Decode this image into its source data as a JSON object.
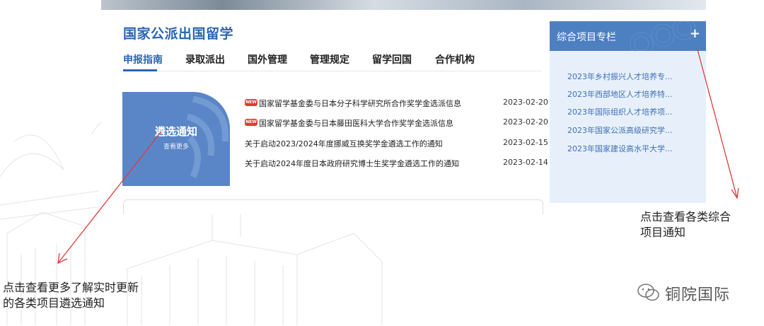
{
  "page": {
    "title": "国家公派出国留学",
    "tabs": [
      {
        "label": "申报指南",
        "active": true
      },
      {
        "label": "录取派出",
        "active": false
      },
      {
        "label": "国外管理",
        "active": false
      },
      {
        "label": "管理规定",
        "active": false
      },
      {
        "label": "留学回国",
        "active": false
      },
      {
        "label": "合作机构",
        "active": false
      }
    ]
  },
  "notice_box": {
    "title": "遴选通知",
    "more": "查看更多"
  },
  "news": [
    {
      "badge": "NEW",
      "title": "国家留学基金委与日本分子科学研究所合作奖学金选派信息",
      "date": "2023-02-20"
    },
    {
      "badge": "NEW",
      "title": "国家留学基金委与日本藤田医科大学合作奖学金选派信息",
      "date": "2023-02-20"
    },
    {
      "badge": "",
      "title": "关于启动2023/2024年度挪威互换奖学金遴选工作的通知",
      "date": "2023-02-15"
    },
    {
      "badge": "",
      "title": "关于启动2024年度日本政府研究博士生奖学金遴选工作的通知",
      "date": "2023-02-14"
    }
  ],
  "side_panel": {
    "title": "综合项目专栏",
    "plus": "+",
    "items": [
      "2023年乡村振兴人才培养专...",
      "2023年西部地区人才培养特...",
      "2023年国际组织人才培养项...",
      "2023年国家公派高级研究学...",
      "2023年国家建设高水平大学..."
    ]
  },
  "annotations": {
    "right": [
      "点击查看各类综合",
      "项目通知"
    ],
    "left": [
      "点击查看更多了解实时更新",
      "的各类项目遴选通知"
    ]
  },
  "watermark": "铜院国际",
  "colors": {
    "brand_blue": "#2a64b4",
    "panel_header": "#4d80c1",
    "panel_bg": "#e7f0fa",
    "notice_box": "#5a86c7",
    "arrow_red": "#e03a3a",
    "new_badge": "#e03a2e"
  }
}
